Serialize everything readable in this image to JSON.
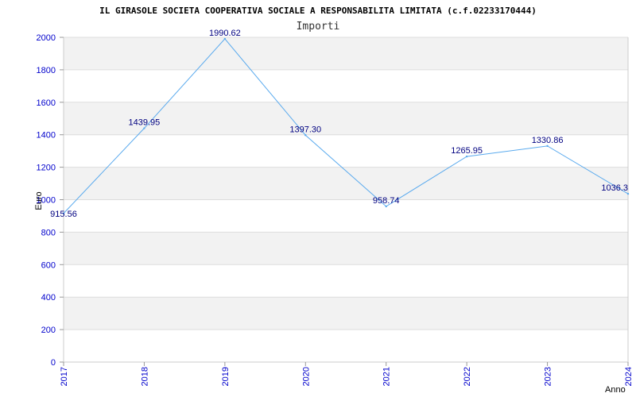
{
  "chart_data": {
    "type": "line",
    "title": "IL GIRASOLE SOCIETA COOPERATIVA SOCIALE A RESPONSABILITA LIMITATA (c.f.02233170444)",
    "subtitle": "Importi",
    "xlabel": "Anno",
    "ylabel": "Euro",
    "ylim": [
      0,
      2000
    ],
    "yticks": [
      0,
      200,
      400,
      600,
      800,
      1000,
      1200,
      1400,
      1600,
      1800,
      2000
    ],
    "categories": [
      "2017",
      "2018",
      "2019",
      "2020",
      "2021",
      "2022",
      "2023",
      "2024"
    ],
    "values": [
      915.56,
      1439.95,
      1990.62,
      1397.3,
      958.74,
      1265.95,
      1330.86,
      1036.3
    ],
    "data_labels": [
      "915.56",
      "1439.95",
      "1990.62",
      "1397.30",
      "958.74",
      "1265.95",
      "1330.86",
      "1036.3"
    ],
    "grid": true,
    "colors": {
      "line": "#5aaaee",
      "band": "#f2f2f2",
      "grid": "#dddddd",
      "tick_text": "#0000cc",
      "data_label": "#000080"
    }
  }
}
